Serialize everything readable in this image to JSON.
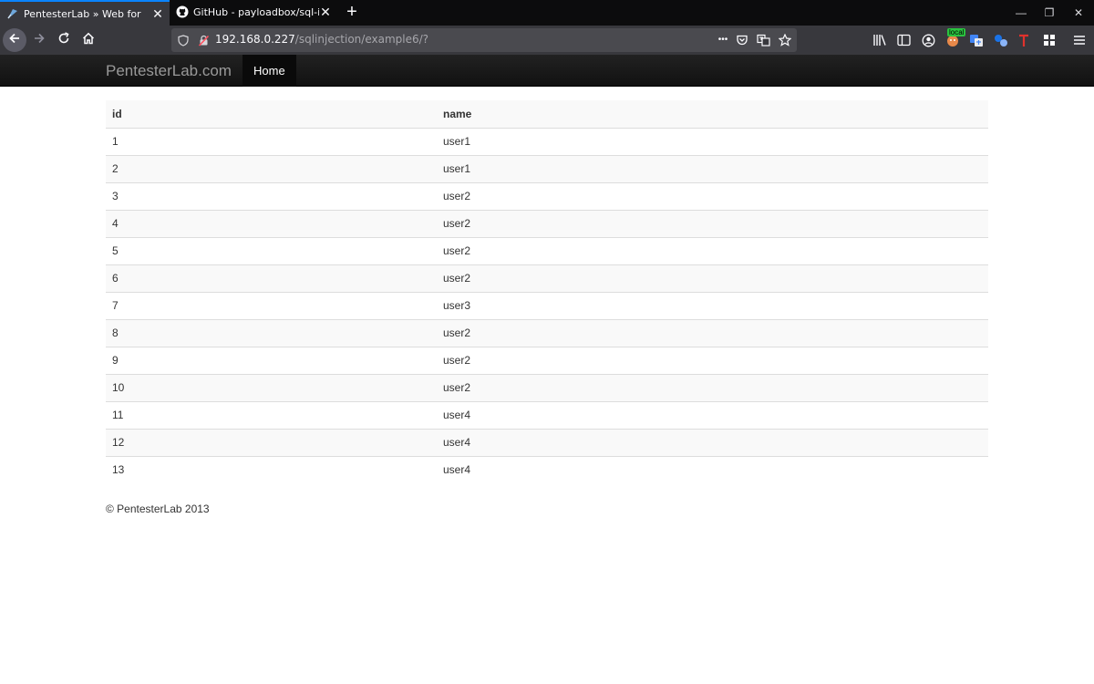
{
  "browser": {
    "tabs": [
      {
        "title": "PentesterLab » Web for Pentest",
        "active": true
      },
      {
        "title": "GitHub - payloadbox/sql-inject",
        "active": false
      }
    ],
    "close_glyph": "✕",
    "new_tab_glyph": "+",
    "window_controls": {
      "minimize": "—",
      "restore": "❐",
      "close": "✕"
    },
    "url": {
      "host": "192.168.0.227",
      "path": "/sqlinjection/example6/?"
    },
    "url_more_glyph": "•••",
    "extension_badge": "local",
    "accent_color": "#0a84ff"
  },
  "site": {
    "brand": "PentesterLab.com",
    "nav_home": "Home"
  },
  "table": {
    "headers": [
      "id",
      "name"
    ],
    "rows": [
      [
        "1",
        "user1"
      ],
      [
        "2",
        "user1"
      ],
      [
        "3",
        "user2"
      ],
      [
        "4",
        "user2"
      ],
      [
        "5",
        "user2"
      ],
      [
        "6",
        "user2"
      ],
      [
        "7",
        "user3"
      ],
      [
        "8",
        "user2"
      ],
      [
        "9",
        "user2"
      ],
      [
        "10",
        "user2"
      ],
      [
        "11",
        "user4"
      ],
      [
        "12",
        "user4"
      ],
      [
        "13",
        "user4"
      ]
    ]
  },
  "footer": "© PentesterLab 2013",
  "icons": [
    "pentesterlab-favicon-icon",
    "github-icon",
    "back-arrow-icon",
    "forward-arrow-icon",
    "reload-icon",
    "home-icon",
    "shield-icon",
    "insecure-lock-icon",
    "pocket-icon",
    "translate-icon",
    "star-icon",
    "library-icon",
    "sidebar-icon",
    "account-icon",
    "extension-icon",
    "menu-icon"
  ]
}
